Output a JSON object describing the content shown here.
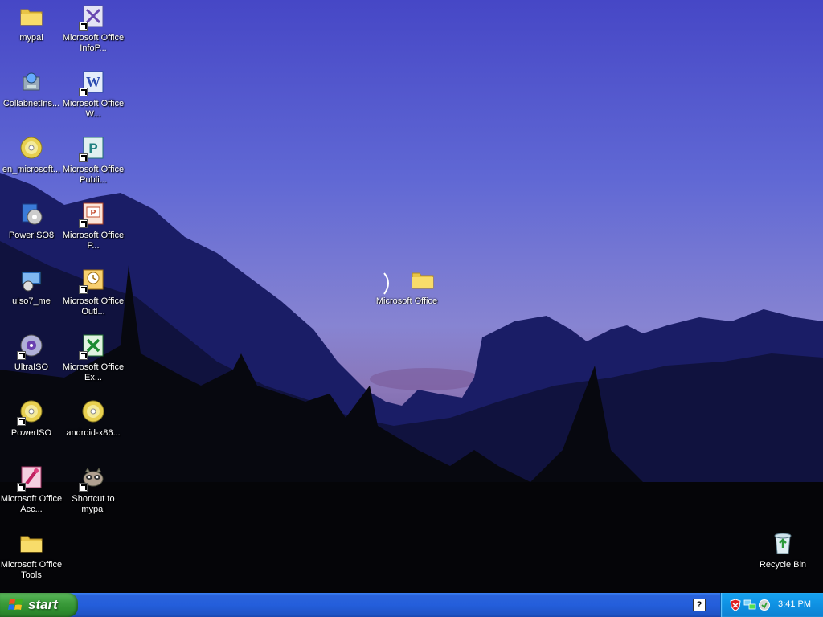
{
  "desktop_icons": [
    {
      "label": "mypal",
      "icon": "folder-icon"
    },
    {
      "label": "Microsoft Office InfoP...",
      "icon": "infopath-icon"
    },
    {
      "label": "CollabnetIns...",
      "icon": "installer-icon"
    },
    {
      "label": "Microsoft Office W...",
      "icon": "word-icon"
    },
    {
      "label": "en_microsoft...",
      "icon": "disc-icon"
    },
    {
      "label": "Microsoft Office Publi...",
      "icon": "publisher-icon"
    },
    {
      "label": "PowerISO8",
      "icon": "poweriso-installer-icon"
    },
    {
      "label": "Microsoft Office P...",
      "icon": "powerpoint-icon"
    },
    {
      "label": "uiso7_me",
      "icon": "ultraiso-installer-icon"
    },
    {
      "label": "Microsoft Office Outl...",
      "icon": "outlook-icon"
    },
    {
      "label": "UltraISO",
      "icon": "ultraiso-icon"
    },
    {
      "label": "Microsoft Office Ex...",
      "icon": "excel-icon"
    },
    {
      "label": "PowerISO",
      "icon": "poweriso-icon"
    },
    {
      "label": "android-x86...",
      "icon": "disc-icon"
    },
    {
      "label": "Microsoft Office Acc...",
      "icon": "access-icon"
    },
    {
      "label": "Shortcut to mypal",
      "icon": "raccoon-icon"
    },
    {
      "label": "Microsoft Office Tools",
      "icon": "folder-icon"
    },
    {
      "label": "Microsoft Office",
      "icon": "folder-icon"
    },
    {
      "label": "Recycle Bin",
      "icon": "recycle-bin-icon"
    }
  ],
  "taskbar": {
    "start_label": "start",
    "clock": "3:41 PM",
    "help_label": "?"
  }
}
